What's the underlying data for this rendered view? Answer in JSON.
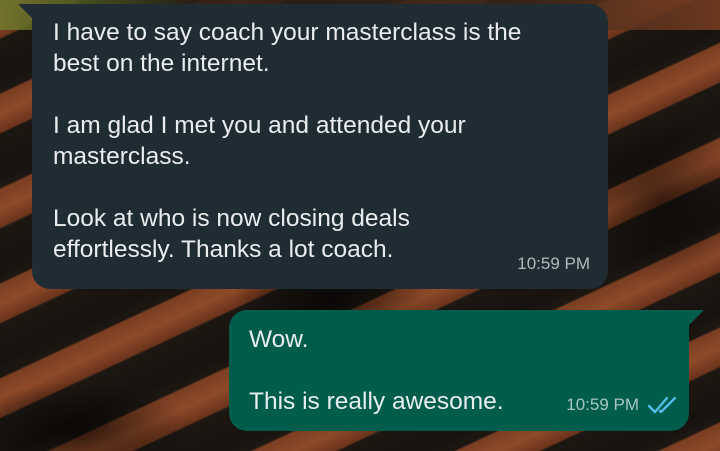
{
  "chat": {
    "incoming": {
      "paragraphs": [
        "I have to say coach your masterclass is the\nbest on the internet.",
        "I am glad I met you and attended your\nmasterclass.",
        "Look at who is now closing deals\neffortlessly. Thanks a lot coach."
      ],
      "time": "10:59 PM",
      "bubble_color": "#202c33"
    },
    "outgoing": {
      "paragraphs": [
        "Wow.",
        "This is really awesome."
      ],
      "time": "10:59 PM",
      "status_icon": "double-check-read-icon",
      "bubble_color": "#005c4b",
      "tick_color": "#53bdeb"
    }
  }
}
